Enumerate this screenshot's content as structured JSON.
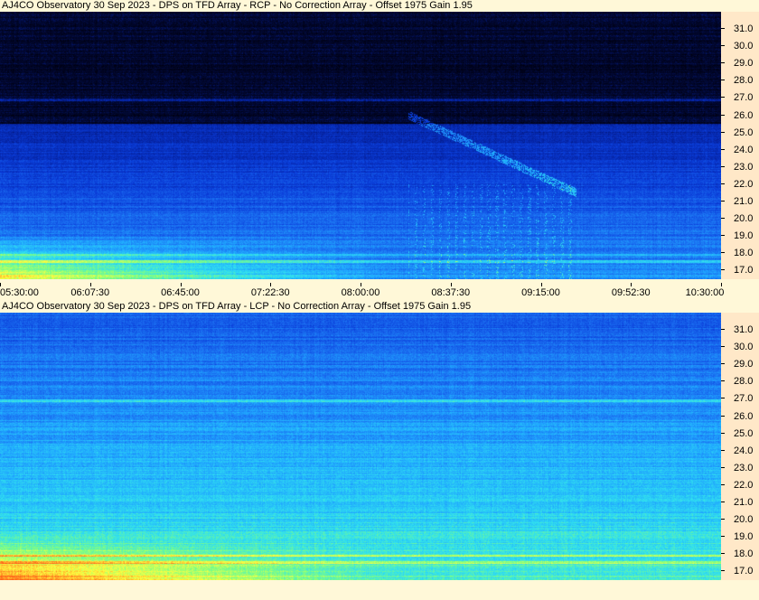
{
  "panels": [
    {
      "title": "AJ4CO Observatory 30 Sep 2023 - DPS on TFD Array  - RCP  -  No Correction Array  -  Offset 1975  Gain 1.95",
      "polarization": "RCP"
    },
    {
      "title": "AJ4CO Observatory 30 Sep 2023 - DPS on TFD Array - LCP  -  No Correction Array  -  Offset 1975  Gain 1.95",
      "polarization": "LCP"
    }
  ],
  "colors": {
    "background": "#fff8d8",
    "axis_panel": "#ffe8c8",
    "colormap": [
      "#000010",
      "#020a3a",
      "#0522a0",
      "#0a3cd8",
      "#1a6cf0",
      "#20a8ff",
      "#30e0f0",
      "#80ff80",
      "#ffff40",
      "#ff8020",
      "#ff2010"
    ]
  },
  "chart_data": [
    {
      "type": "heatmap",
      "title": "AJ4CO Observatory 30 Sep 2023 - DPS on TFD Array  - RCP  -  No Correction Array  -  Offset 1975  Gain 1.95",
      "xlabel": "",
      "ylabel": "",
      "x_ticks": [
        "05:30:00",
        "06:07:30",
        "06:45:00",
        "07:22:30",
        "08:00:00",
        "08:37:30",
        "09:15:00",
        "09:52:30",
        "10:30:00"
      ],
      "y_ticks": [
        "17.0",
        "18.0",
        "19.0",
        "20.0",
        "21.0",
        "22.0",
        "23.0",
        "24.0",
        "25.0",
        "26.0",
        "27.0",
        "28.0",
        "29.0",
        "30.0",
        "31.0"
      ],
      "ylim": [
        16.5,
        32.0
      ],
      "x_range": [
        "05:30:00",
        "10:30:00"
      ],
      "features": {
        "dark_above_mhz": 25.5,
        "interference_lines_mhz": [
          26.9,
          17.5,
          17.9
        ],
        "burst_window": [
          "08:20:00",
          "09:30:00"
        ]
      }
    },
    {
      "type": "heatmap",
      "title": "AJ4CO Observatory 30 Sep 2023 - DPS on TFD Array - LCP  -  No Correction Array  -  Offset 1975  Gain 1.95",
      "xlabel": "",
      "ylabel": "",
      "y_ticks": [
        "17.0",
        "18.0",
        "19.0",
        "20.0",
        "21.0",
        "22.0",
        "23.0",
        "24.0",
        "25.0",
        "26.0",
        "27.0",
        "28.0",
        "29.0",
        "30.0",
        "31.0"
      ],
      "ylim": [
        16.5,
        32.0
      ],
      "x_range": [
        "05:30:00",
        "10:30:00"
      ],
      "features": {
        "interference_lines_mhz": [
          26.9,
          17.5,
          17.9
        ]
      }
    }
  ]
}
